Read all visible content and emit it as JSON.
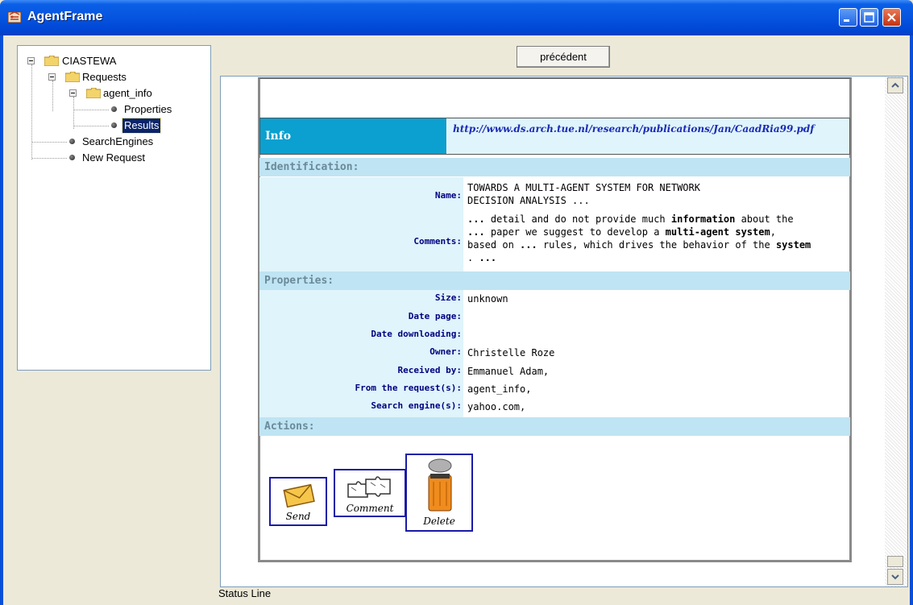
{
  "window": {
    "title": "AgentFrame"
  },
  "tree": {
    "root": "CIASTEWA",
    "requests": "Requests",
    "agent_info": "agent_info",
    "properties": "Properties",
    "results": "Results",
    "search_engines": "SearchEngines",
    "new_request": "New Request"
  },
  "toolbar": {
    "previous_label": "précédent"
  },
  "info": {
    "label": "Info",
    "url": "http://www.ds.arch.tue.nl/research/publications/Jan/CaadRia99.pdf"
  },
  "identification": {
    "section": "Identification:",
    "name_label": "Name:",
    "name_line1": "TOWARDS A MULTI-AGENT SYSTEM FOR NETWORK",
    "name_line2": "DECISION ANALYSIS ...",
    "comments_label": "Comments:",
    "comments": {
      "l1a": "...",
      "l1b": " detail and do not provide much ",
      "l1c": "information",
      "l1d": " about the",
      "l2a": "...",
      "l2b": " paper we suggest to develop a ",
      "l2c": "multi-agent system",
      "l2d": ",",
      "l3a": "based on ",
      "l3b": "...",
      "l3c": " rules, which drives the behavior of the ",
      "l3d": "system",
      "l4a": ". ",
      "l4b": "..."
    }
  },
  "properties": {
    "section": "Properties:",
    "size_label": "Size:",
    "size_value": "unknown",
    "date_page_label": "Date page:",
    "date_page_value": "",
    "date_downloading_label": "Date downloading:",
    "date_downloading_value": "",
    "owner_label": "Owner:",
    "owner_value": "Christelle Roze",
    "received_label": "Received by:",
    "received_value": "Emmanuel Adam,",
    "from_request_label": "From the request(s):",
    "from_request_value": "agent_info,",
    "search_engine_label": "Search engine(s):",
    "search_engine_value": "yahoo.com,"
  },
  "actions": {
    "section": "Actions:",
    "send": "Send",
    "comment": "Comment",
    "delete": "Delete"
  },
  "status": {
    "text": "Status Line"
  },
  "colors": {
    "titlebar": "#0654e0",
    "info_header": "#0ba0cf",
    "section_bg": "#bfe4f3",
    "label_bg": "#dff4fb",
    "label_text": "#000080"
  }
}
